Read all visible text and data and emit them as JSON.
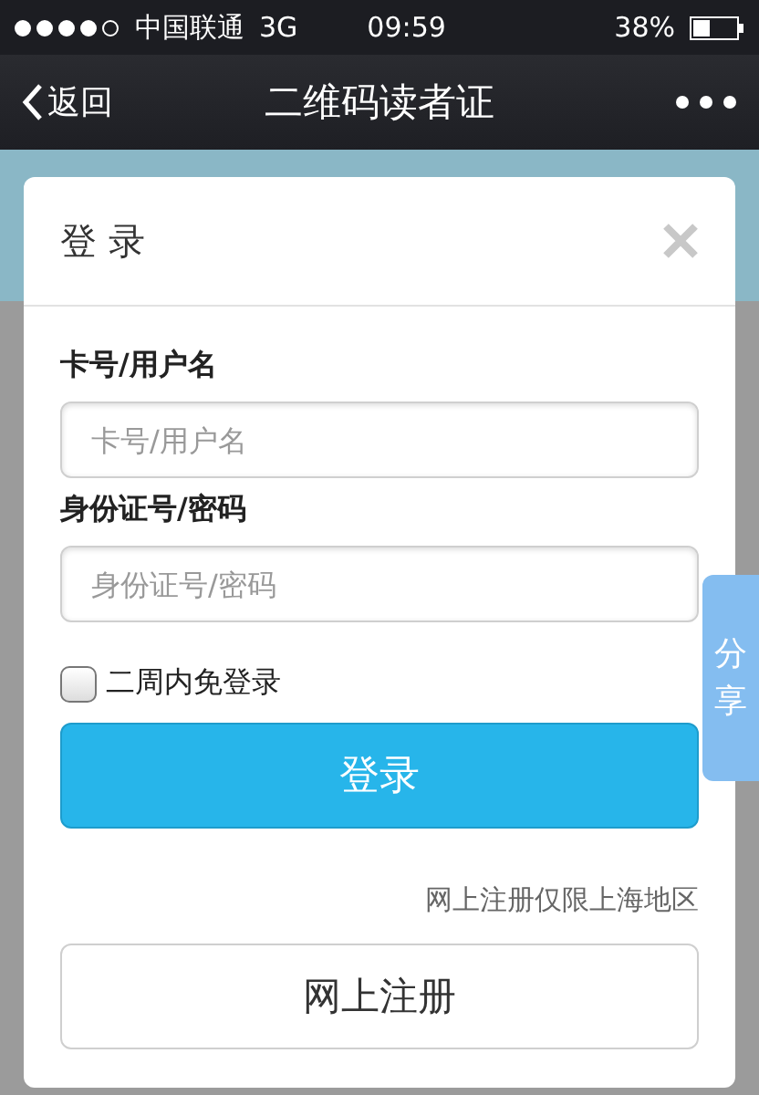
{
  "status_bar": {
    "carrier": "中国联通",
    "network": "3G",
    "time": "09:59",
    "battery": "38%"
  },
  "nav_bar": {
    "back_label": "返回",
    "title": "二维码读者证"
  },
  "dialog": {
    "title": "登 录",
    "fields": [
      {
        "label": "卡号/用户名",
        "placeholder": "卡号/用户名"
      },
      {
        "label": "身份证号/密码",
        "placeholder": "身份证号/密码"
      }
    ],
    "remember": {
      "label": "二周内免登录",
      "checked": false
    },
    "login_button": "登录",
    "note": "网上注册仅限上海地区",
    "register_button": "网上注册"
  },
  "share_tab": "分享"
}
